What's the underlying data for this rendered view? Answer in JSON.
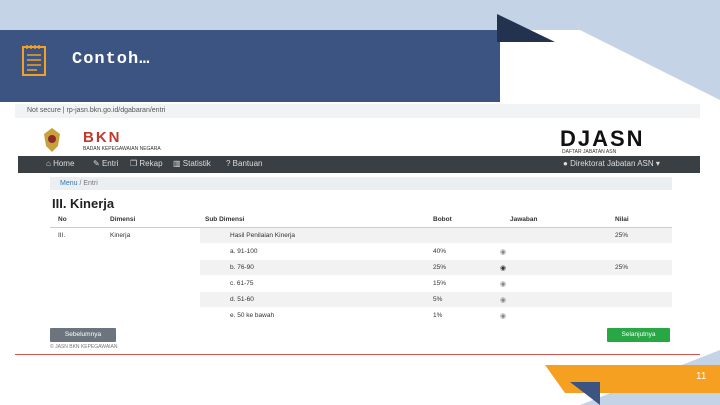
{
  "slide": {
    "title": "Contoh…",
    "page_number": "11"
  },
  "browser": {
    "address": "Not secure  |  rp-jasn.bkn.go.id/dgabaran/entri"
  },
  "header": {
    "bkn": "BKN",
    "bkn_sub": "BADAN KEPEGAWAIAN NEGARA",
    "djasn": "DJASN",
    "djasn_sub": "DAFTAR JABATAN ASN"
  },
  "navbar": {
    "home": "Home",
    "entri": "Entri",
    "rekap": "Rekap",
    "statistik": "Statistik",
    "bantuan": "Bantuan",
    "user": "Direktorat Jabatan ASN"
  },
  "breadcrumb": {
    "menu": "Menu",
    "sep": "/",
    "current": "Entri"
  },
  "section": {
    "title": "III. Kinerja"
  },
  "table": {
    "headers": [
      "No",
      "Dimensi",
      "Sub Dimensi",
      "Bobot",
      "Jawaban",
      "Nilai"
    ],
    "first_row": {
      "no": "III.",
      "dimensi": "Kinerja",
      "sub": "Hasil Penilaian Kinerja",
      "nilai": "25%"
    },
    "rows": [
      {
        "sub": "a. 91-100",
        "bobot": "40%",
        "nilai": ""
      },
      {
        "sub": "b. 76-90",
        "bobot": "25%",
        "nilai": "25%"
      },
      {
        "sub": "c. 61-75",
        "bobot": "15%",
        "nilai": ""
      },
      {
        "sub": "d. 51-60",
        "bobot": "5%",
        "nilai": ""
      },
      {
        "sub": "e. 50 ke bawah",
        "bobot": "1%",
        "nilai": ""
      }
    ]
  },
  "buttons": {
    "prev": "Sebelumnya",
    "next": "Selanjutnya"
  },
  "footer": {
    "text": "© JASN BKN KEPEGAWAIAN"
  }
}
